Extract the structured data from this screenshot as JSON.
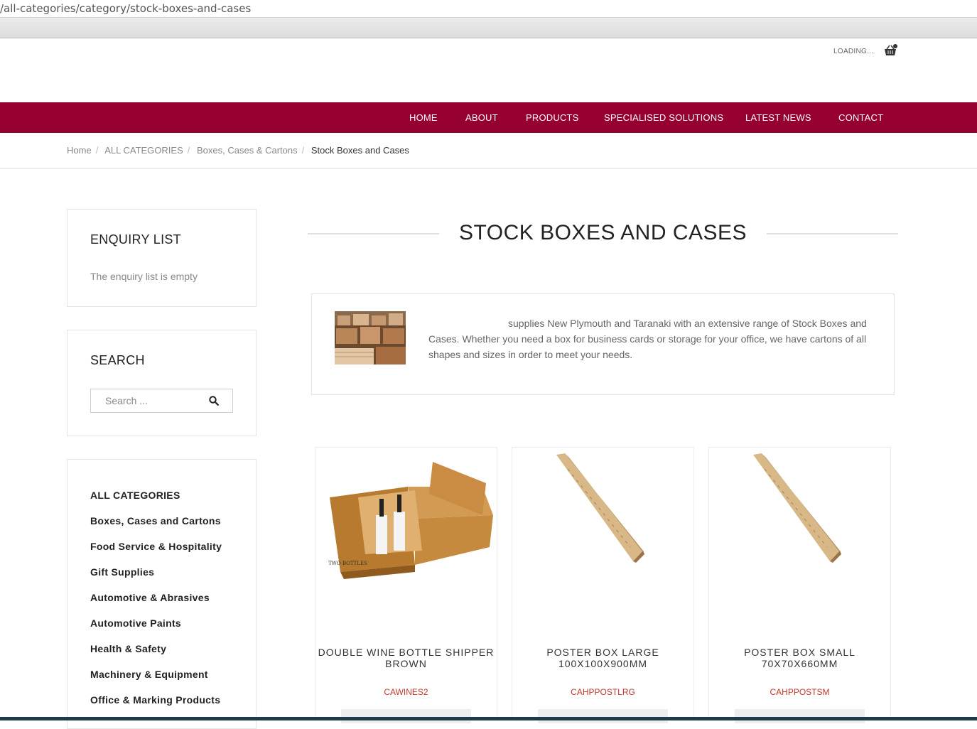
{
  "browser": {
    "url": "/all-categories/category/stock-boxes-and-cases"
  },
  "header": {
    "loading_text": "LOADING..."
  },
  "nav": {
    "items": [
      {
        "label": "HOME"
      },
      {
        "label": "ABOUT"
      },
      {
        "label": "PRODUCTS"
      },
      {
        "label": "SPECIALISED SOLUTIONS"
      },
      {
        "label": "LATEST NEWS"
      },
      {
        "label": "CONTACT"
      }
    ]
  },
  "breadcrumb": {
    "items": [
      "Home",
      "ALL CATEGORIES",
      "Boxes, Cases & Cartons"
    ],
    "separator": "/",
    "current": "Stock Boxes and Cases"
  },
  "sidebar": {
    "enquiry": {
      "title": "ENQUIRY LIST",
      "empty_text": "The enquiry list is empty"
    },
    "search": {
      "title": "SEARCH",
      "placeholder": "Search ..."
    },
    "categories": [
      "ALL CATEGORIES",
      "Boxes, Cases and Cartons",
      "Food Service & Hospitality",
      "Gift Supplies",
      "Automotive & Abrasives",
      "Automotive Paints",
      "Health & Safety",
      "Machinery & Equipment",
      "Office & Marking Products"
    ]
  },
  "main": {
    "title": "STOCK BOXES AND CASES",
    "description": "supplies New Plymouth and Taranaki with an extensive range of Stock Boxes and Cases. Whether you need a box for business cards or storage for your office, we have cartons of all shapes and sizes in order to meet your needs."
  },
  "products": [
    {
      "name": "DOUBLE WINE BOTTLE SHIPPER BROWN",
      "code": "CAWINES2",
      "image_caption": "TWO BOTTLES"
    },
    {
      "name": "POSTER BOX LARGE 100X100X900MM",
      "code": "CAHPPOSTLRG"
    },
    {
      "name": "POSTER BOX SMALL 70X70X660MM",
      "code": "CAHPPOSTSM"
    }
  ],
  "colors": {
    "nav_bg": "#950030",
    "code_text": "#c0392b"
  }
}
